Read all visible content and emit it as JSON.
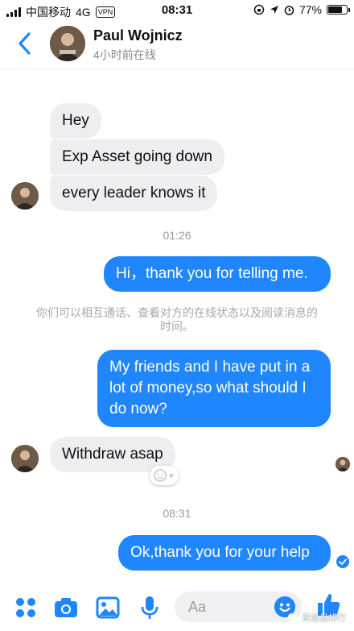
{
  "status_bar": {
    "carrier": "中国移动",
    "network": "4G",
    "vpn": "VPN",
    "time": "08:31",
    "battery_percent": "77%",
    "battery_level": 0.77
  },
  "header": {
    "name": "Paul Wojnicz",
    "presence": "4小时前在线",
    "accent": "#1f86fe"
  },
  "messages": {
    "m1": "Hey",
    "m2": "Exp Asset going down",
    "m3": "every leader knows it",
    "t1": "01:26",
    "m4": "Hi，thank you for telling me.",
    "notice": "你们可以相互通话、查看对方的在线状态以及阅读消息的时间。",
    "m5": "My friends and I have put in a lot of money,so what should I do now?",
    "m6": "Withdraw asap",
    "t2": "08:31",
    "m7": "Ok,thank you for your help"
  },
  "composer": {
    "placeholder": "Aa"
  },
  "watermark": "资金盘排行",
  "icons": [
    "back-chevron-icon",
    "apps-icon",
    "camera-icon",
    "image-icon",
    "microphone-icon",
    "emoji-icon",
    "like-icon",
    "reaction-add-icon",
    "read-receipt-icon"
  ]
}
